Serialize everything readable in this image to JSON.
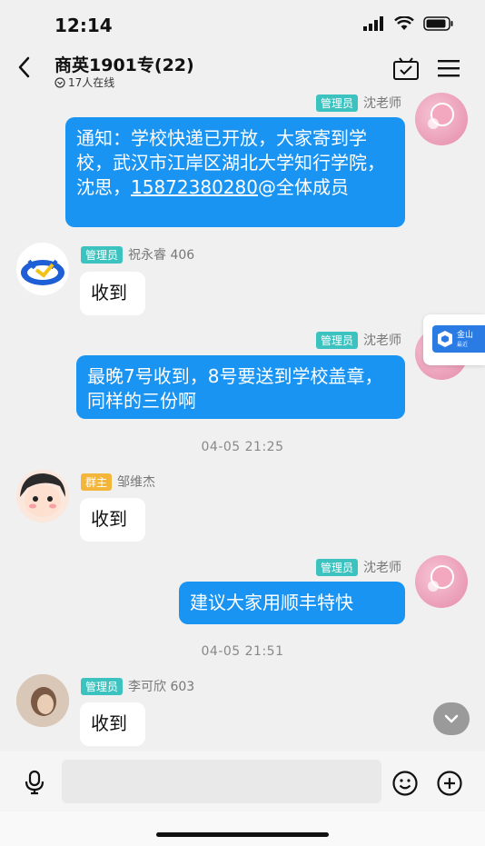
{
  "status_bar": {
    "time": "12:14"
  },
  "header": {
    "title": "商英1901专(22)",
    "online": "17人在线"
  },
  "messages": [
    {
      "sender": "沈老师",
      "role": "管理员",
      "text": "通知：学校快递已开放，大家寄到学校，武汉市江岸区湖北大学知行学院，沈思，",
      "phone": "15872380280",
      "mention": "@全体成员"
    },
    {
      "sender": "祝永睿 406",
      "role": "管理员",
      "text": "收到"
    },
    {
      "sender": "沈老师",
      "role": "管理员",
      "text": "最晚7号收到，8号要送到学校盖章，同样的三份啊"
    },
    {
      "sender": "邹维杰",
      "role": "群主",
      "text": "收到"
    },
    {
      "sender": "沈老师",
      "role": "管理员",
      "text": "建议大家用顺丰特快"
    },
    {
      "sender": "李可欣 603",
      "role": "管理员",
      "text": "收到"
    }
  ],
  "time_separators": [
    "04-05 21:25",
    "04-05 21:51"
  ],
  "floating_card": {
    "title": "金山",
    "subtitle": "最近"
  },
  "colors": {
    "bubble_out": "#1a94f3",
    "badge_admin": "#3cc3c0",
    "badge_owner": "#f4b63a",
    "background": "#f0f0f0"
  }
}
